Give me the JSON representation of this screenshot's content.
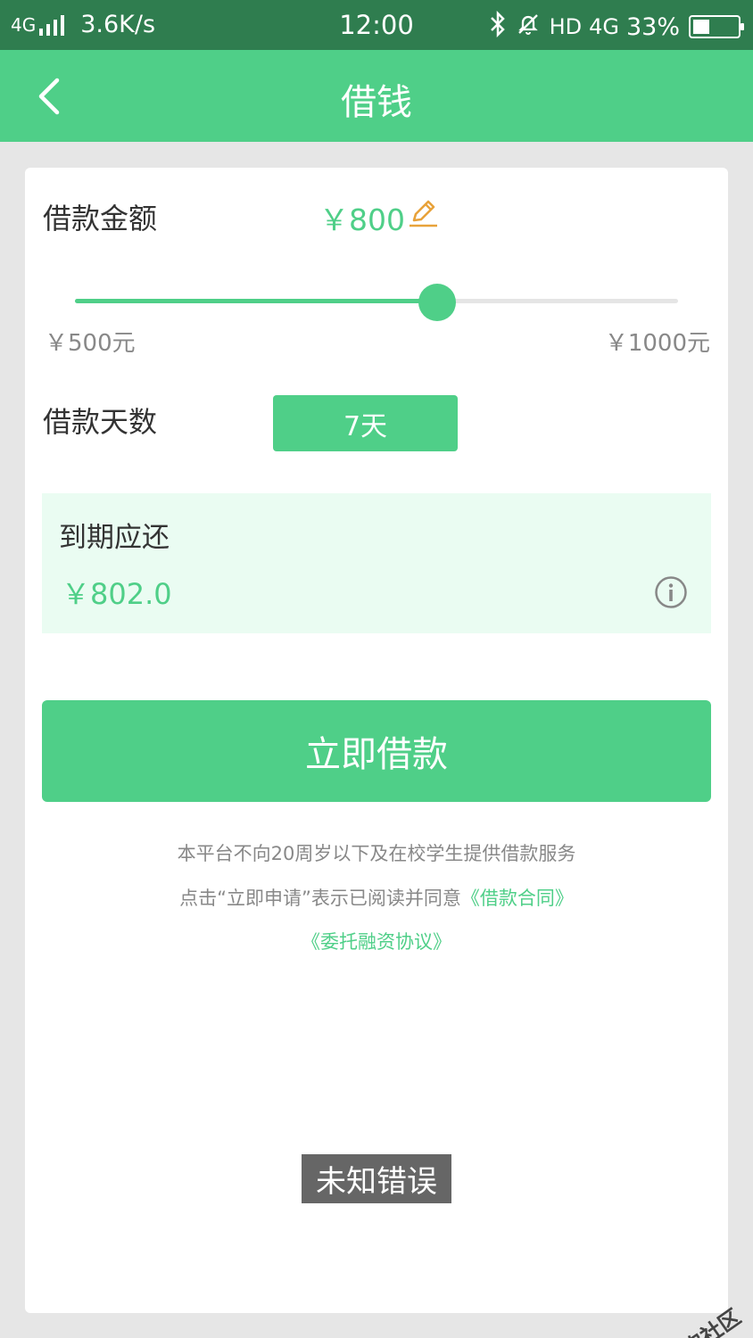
{
  "status_bar": {
    "network": "4G",
    "speed": "3.6K/s",
    "time": "12:00",
    "hd": "HD",
    "network_right": "4G",
    "battery": "33%",
    "battery_level": 0.33
  },
  "header": {
    "title": "借钱"
  },
  "loan": {
    "amount_label": "借款金额",
    "amount_value": "￥800",
    "slider": {
      "min_label": "￥500元",
      "max_label": "￥1000元",
      "min": 500,
      "max": 1000,
      "value": 800
    },
    "days_label": "借款天数",
    "days_value": "7天"
  },
  "due": {
    "label": "到期应还",
    "value": "￥802.0"
  },
  "submit_label": "立即借款",
  "notice": {
    "line1": "本平台不向20周岁以下及在校学生提供借款服务",
    "line2_prefix": "点击“立即申请”表示已阅读并同意",
    "contract_link": "《借款合同》",
    "agreement_link": "《委托融资协议》"
  },
  "toast": "未知错误",
  "watermark": "卡农社区",
  "colors": {
    "status_bar": "#2f7d4f",
    "accent": "#4fcf88",
    "due_bg": "#eafcf2",
    "edit_icon": "#e8a23a"
  }
}
